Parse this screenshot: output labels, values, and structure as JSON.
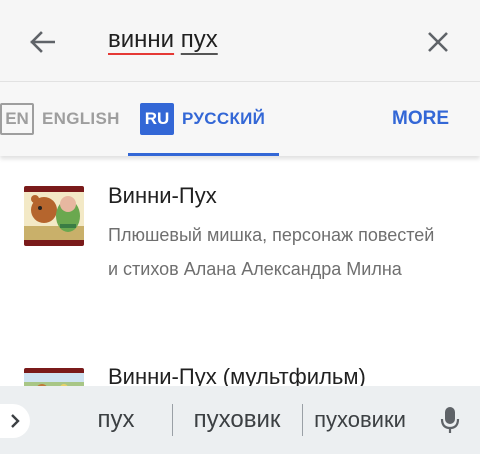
{
  "search": {
    "query_word1": "винни",
    "query_word2": "пух"
  },
  "languages": {
    "en_code": "EN",
    "en_label": "ENGLISH",
    "ru_code": "RU",
    "ru_label": "РУССКИЙ",
    "more_label": "MORE",
    "selected": "RU"
  },
  "results": [
    {
      "title": "Винни-Пух",
      "description": "Плюшевый мишка, персонаж повестей и стихов Алана Александра Милна"
    },
    {
      "title": "Винни-Пух (мультфильм)"
    }
  ],
  "keyboard": {
    "suggestions": [
      "пух",
      "пуховик",
      "пуховики"
    ]
  },
  "colors": {
    "accent": "#3367d6",
    "spell_underline": "#e53935"
  },
  "icons": {
    "back": "arrow-back-icon",
    "clear": "close-icon",
    "expand": "chevron-right-icon",
    "mic": "microphone-icon"
  }
}
